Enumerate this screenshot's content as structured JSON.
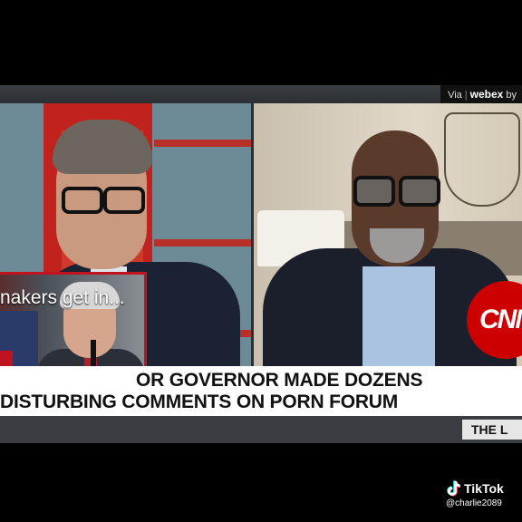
{
  "webex": {
    "via": "Via",
    "brand": "webex",
    "suffix": "by"
  },
  "pip": {
    "caption": "nakers get in..."
  },
  "chyron": {
    "line1": "OR GOVERNOR MADE DOZENS",
    "line2": "DISTURBING COMMENTS ON PORN FORUM"
  },
  "network_logo": "CNN",
  "ticker": {
    "label": "THE L"
  },
  "tiktok": {
    "brand": "TikTok",
    "username": "@charlie2089"
  },
  "colors": {
    "cnn_red": "#cc0000",
    "frame_red": "#c1121f"
  }
}
